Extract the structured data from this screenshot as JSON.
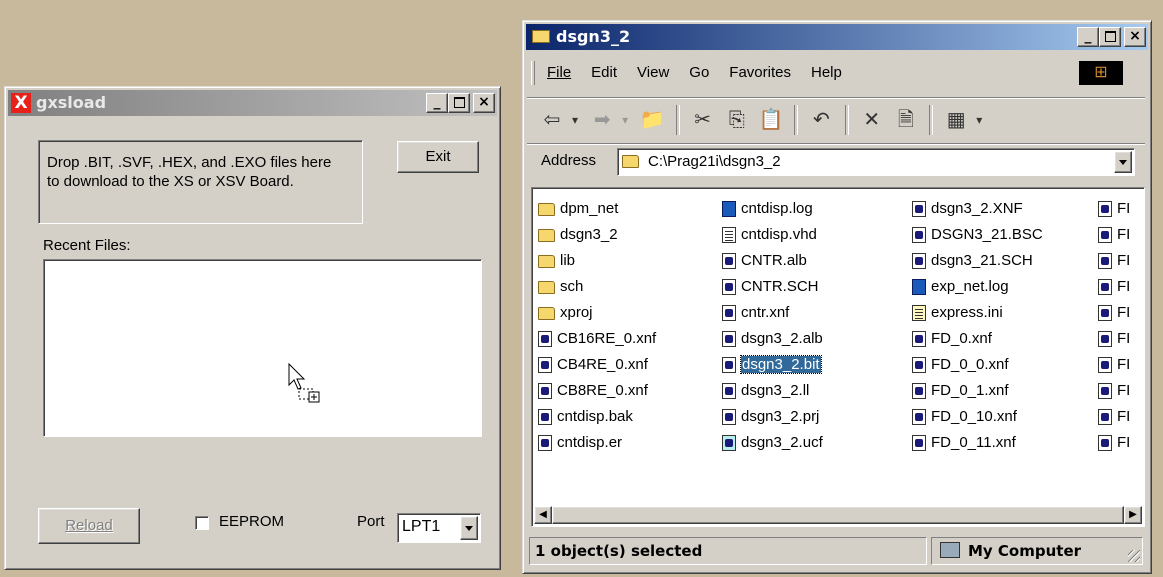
{
  "gxsload": {
    "title": "gxsload",
    "instructions": "Drop .BIT, .SVF, .HEX, and .EXO files here to download to the XS or XSV Board.",
    "exit_label": "Exit",
    "recent_files_label": "Recent Files:",
    "reload_label": "Reload",
    "eeprom_label": "EEPROM",
    "eeprom_checked": false,
    "port_label": "Port",
    "port_value": "LPT1"
  },
  "explorer": {
    "title": "dsgn3_2",
    "menu": [
      "File",
      "Edit",
      "View",
      "Go",
      "Favorites",
      "Help"
    ],
    "address_label": "Address",
    "address_value": "C:\\Prag21i\\dsgn3_2",
    "columns": [
      [
        {
          "name": "dpm_net",
          "icon": "folder-icon"
        },
        {
          "name": "dsgn3_2",
          "icon": "folder-icon"
        },
        {
          "name": "lib",
          "icon": "folder-icon"
        },
        {
          "name": "sch",
          "icon": "folder-icon"
        },
        {
          "name": "xproj",
          "icon": "folder-icon"
        },
        {
          "name": "CB16RE_0.xnf",
          "icon": "file-icon"
        },
        {
          "name": "CB4RE_0.xnf",
          "icon": "file-icon"
        },
        {
          "name": "CB8RE_0.xnf",
          "icon": "file-icon"
        },
        {
          "name": "cntdisp.bak",
          "icon": "file-icon"
        },
        {
          "name": "cntdisp.er",
          "icon": "file-icon"
        }
      ],
      [
        {
          "name": "cntdisp.log",
          "icon": "log-file-icon"
        },
        {
          "name": "cntdisp.vhd",
          "icon": "text-file-icon"
        },
        {
          "name": "CNTR.alb",
          "icon": "file-icon"
        },
        {
          "name": "CNTR.SCH",
          "icon": "file-icon"
        },
        {
          "name": "cntr.xnf",
          "icon": "file-icon"
        },
        {
          "name": "dsgn3_2.alb",
          "icon": "file-icon"
        },
        {
          "name": "dsgn3_2.bit",
          "icon": "file-icon",
          "selected": true
        },
        {
          "name": "dsgn3_2.ll",
          "icon": "file-icon"
        },
        {
          "name": "dsgn3_2.prj",
          "icon": "file-icon"
        },
        {
          "name": "dsgn3_2.ucf",
          "icon": "ucf-file-icon"
        }
      ],
      [
        {
          "name": "dsgn3_2.XNF",
          "icon": "file-icon"
        },
        {
          "name": "DSGN3_21.BSC",
          "icon": "file-icon"
        },
        {
          "name": "dsgn3_21.SCH",
          "icon": "file-icon"
        },
        {
          "name": "exp_net.log",
          "icon": "log-file-icon"
        },
        {
          "name": "express.ini",
          "icon": "ini-file-icon"
        },
        {
          "name": "FD_0.xnf",
          "icon": "file-icon"
        },
        {
          "name": "FD_0_0.xnf",
          "icon": "file-icon"
        },
        {
          "name": "FD_0_1.xnf",
          "icon": "file-icon"
        },
        {
          "name": "FD_0_10.xnf",
          "icon": "file-icon"
        },
        {
          "name": "FD_0_11.xnf",
          "icon": "file-icon"
        }
      ],
      [
        {
          "name": "FI",
          "icon": "file-icon"
        },
        {
          "name": "FI",
          "icon": "file-icon"
        },
        {
          "name": "FI",
          "icon": "file-icon"
        },
        {
          "name": "FI",
          "icon": "file-icon"
        },
        {
          "name": "FI",
          "icon": "file-icon"
        },
        {
          "name": "FI",
          "icon": "file-icon"
        },
        {
          "name": "FI",
          "icon": "file-icon"
        },
        {
          "name": "FI",
          "icon": "file-icon"
        },
        {
          "name": "FI",
          "icon": "file-icon"
        },
        {
          "name": "FI",
          "icon": "file-icon"
        }
      ]
    ],
    "status_text": "1 object(s) selected",
    "status_zone": "My Computer"
  }
}
